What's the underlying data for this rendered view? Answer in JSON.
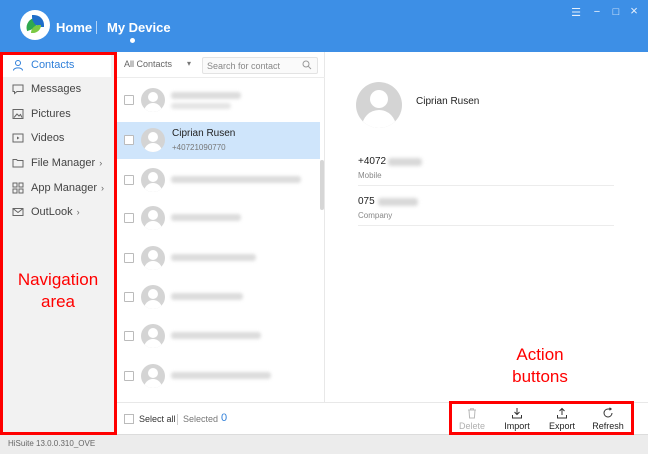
{
  "titlebar": {
    "home": "Home",
    "device": "My Device",
    "controls": {
      "menu": "☰",
      "minimize": "−",
      "maximize": "□",
      "close": "×"
    }
  },
  "sidebar": {
    "items": [
      {
        "label": "Contacts",
        "icon": "person-icon",
        "active": true
      },
      {
        "label": "Messages",
        "icon": "chat-bubble-icon"
      },
      {
        "label": "Pictures",
        "icon": "picture-icon"
      },
      {
        "label": "Videos",
        "icon": "video-icon"
      },
      {
        "label": "File Manager",
        "icon": "folder-icon",
        "chevron": "›"
      },
      {
        "label": "App Manager",
        "icon": "apps-grid-icon",
        "chevron": "›"
      },
      {
        "label": "OutLook",
        "icon": "mail-icon",
        "chevron": "›"
      }
    ]
  },
  "list": {
    "filter": "All Contacts",
    "search_placeholder": "Search for contact",
    "selected_contact": {
      "name": "Ciprian Rusen",
      "phone": "+40721090770"
    }
  },
  "detail": {
    "name": "Ciprian Rusen",
    "phone_value": "+4072",
    "phone_label": "Mobile",
    "company_value": "075",
    "company_label": "Company"
  },
  "bottom": {
    "select_all": "Select all",
    "selected_label": "Selected",
    "selected_count": "0",
    "actions": {
      "delete": "Delete",
      "import": "Import",
      "export": "Export",
      "refresh": "Refresh"
    }
  },
  "status": {
    "version": "HiSuite 13.0.0.310_OVE"
  },
  "annotations": {
    "navigation": "Navigation area",
    "navigation_line1": "Navigation",
    "navigation_line2": "area",
    "actions_line1": "Action",
    "actions_line2": "buttons",
    "color": "#ff0000"
  },
  "colors": {
    "accent": "#3d8fe6",
    "selected_row": "#cfe5fb",
    "link": "#2f7fd9"
  }
}
